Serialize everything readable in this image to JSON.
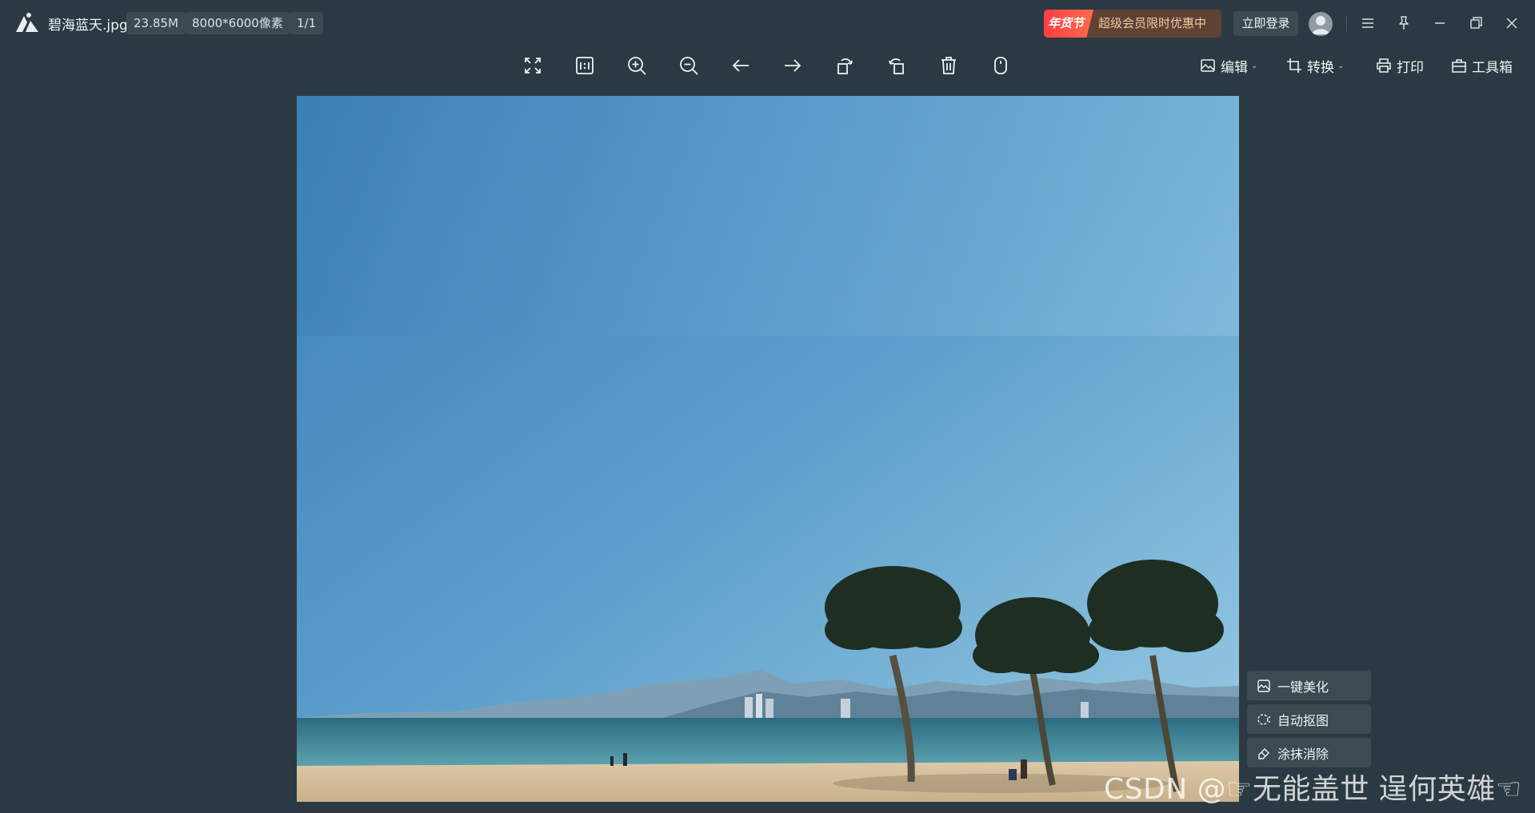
{
  "titlebar": {
    "filename": "碧海蓝天.jpg",
    "file_size": "23.85M",
    "dimensions": "8000*6000像素",
    "page_index": "1/1",
    "promo_tag": "年货节",
    "promo_text": "超级会员限时优惠中",
    "login_label": "立即登录"
  },
  "toolbar": {
    "icons": [
      "fullscreen-icon",
      "actual-size-icon",
      "zoom-in-icon",
      "zoom-out-icon",
      "previous-icon",
      "next-icon",
      "rotate-left-icon",
      "rotate-right-icon",
      "delete-icon",
      "mouse-icon"
    ],
    "edit_label": "编辑",
    "convert_label": "转换",
    "print_label": "打印",
    "toolbox_label": "工具箱"
  },
  "side_tools": {
    "beautify_label": "一键美化",
    "cutout_label": "自动抠图",
    "erase_label": "涂抹消除"
  },
  "watermark": "CSDN @☞无能盖世 逞何英雄☜"
}
